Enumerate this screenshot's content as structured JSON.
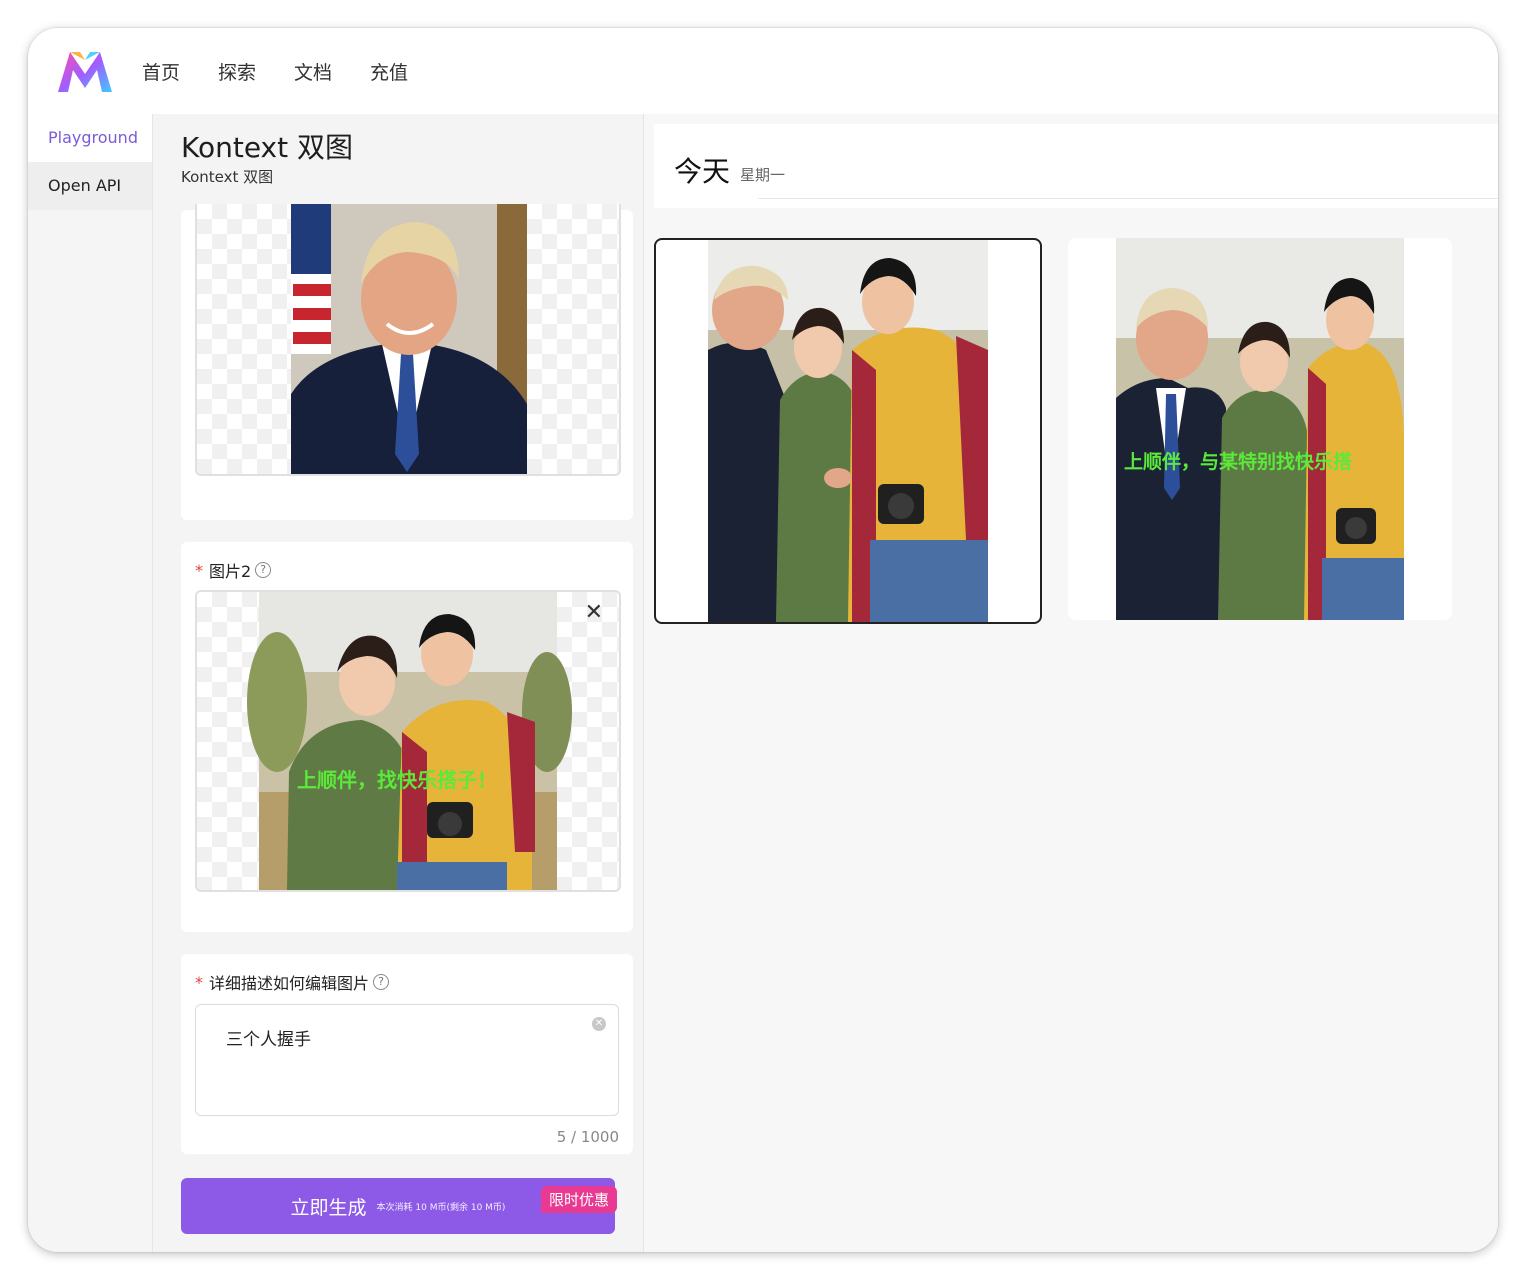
{
  "nav": {
    "items": [
      {
        "label": "首页"
      },
      {
        "label": "探索"
      },
      {
        "label": "文档"
      },
      {
        "label": "充值"
      }
    ]
  },
  "sidebar": {
    "items": [
      {
        "label": "Playground",
        "active": true
      },
      {
        "label": "Open API",
        "active": false
      }
    ]
  },
  "panel": {
    "title": "Kontext 双图",
    "subtitle": "Kontext 双图"
  },
  "image2": {
    "required_mark": "*",
    "label": "图片2",
    "help_icon": "question-icon",
    "remove_icon": "close-icon",
    "overlay_text": "上顺伴，找快乐搭子！"
  },
  "prompt": {
    "required_mark": "*",
    "label": "详细描述如何编辑图片",
    "help_icon": "question-icon",
    "value": "三个人握手",
    "counter": "5 / 1000"
  },
  "generate": {
    "label": "立即生成",
    "cost": "本次消耗 10 M币(剩余 10 M币)",
    "promo": "限时优惠"
  },
  "results": {
    "date": "今天",
    "weekday": "星期一",
    "image2_overlay_text": "上顺伴，与某特别找快乐搭"
  },
  "colors": {
    "accent": "#8d5ae8",
    "active_text": "#7b5bd6",
    "promo": "#e83a93",
    "required": "#e0453a"
  }
}
